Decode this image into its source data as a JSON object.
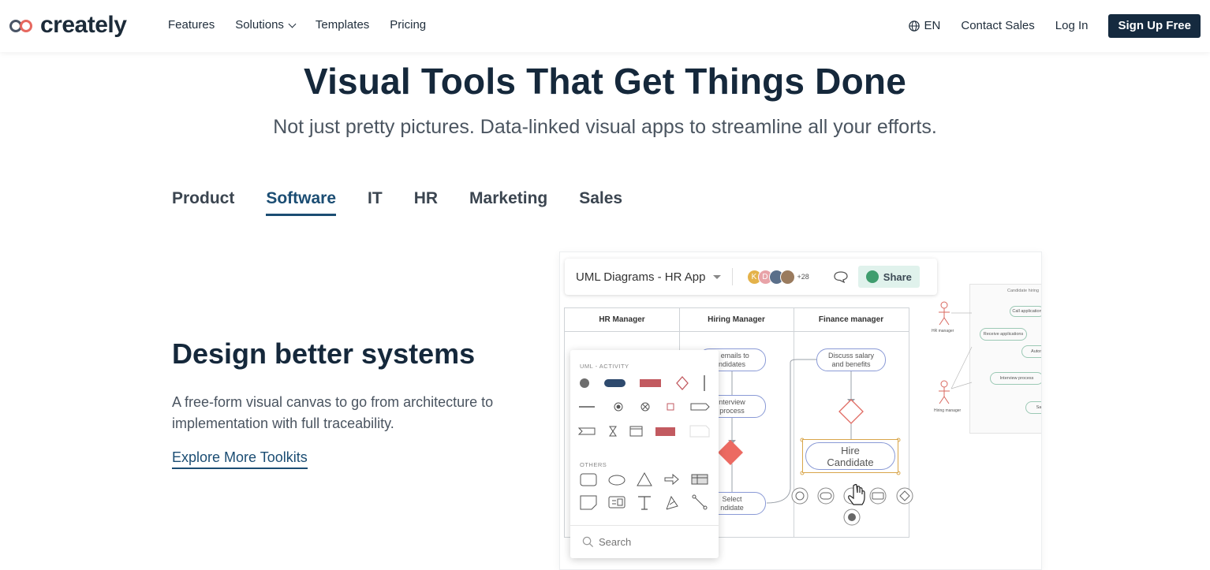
{
  "brand": {
    "name": "creately"
  },
  "nav": {
    "links": [
      "Features",
      "Solutions",
      "Templates",
      "Pricing"
    ],
    "lang": "EN",
    "contact": "Contact Sales",
    "login": "Log In",
    "signup": "Sign Up Free"
  },
  "hero": {
    "title": "Visual Tools That Get Things Done",
    "subtitle": "Not just pretty pictures. Data-linked visual apps to streamline all your efforts."
  },
  "tabs": [
    "Product",
    "Software",
    "IT",
    "HR",
    "Marketing",
    "Sales"
  ],
  "active_tab": "Software",
  "section": {
    "title": "Design better systems",
    "description": "A free-form visual canvas to go from architecture to implementation with full traceability.",
    "link": "Explore More Toolkits"
  },
  "app": {
    "doc_title": "UML Diagrams - HR App",
    "avatars": [
      "K",
      "D"
    ],
    "avatar_more": "+28",
    "share": "Share",
    "lanes": [
      "HR Manager",
      "Hiring Manager",
      "Finance manager"
    ],
    "nodes": {
      "emails": "d emails to\nndidates",
      "interview": "nterview\nprocess",
      "select": "Select\nndidate",
      "salary": "Discuss salary\nand benefits",
      "hire": "Hire\nCandidate"
    },
    "mini": {
      "title": "Candidate hiring",
      "actor1": "HR manager",
      "actor2": "Hiring manager",
      "uc1": "Call application",
      "uc2": "Receive applications",
      "uc3": "Autom",
      "uc4": "Interview process",
      "uc5": "Salar"
    },
    "panel": {
      "section1": "UML - ACTIVITY",
      "section2": "OTHERS",
      "search_placeholder": "Search"
    }
  },
  "colors": {
    "brand_dark": "#152a3f",
    "accent_blue": "#1b4d73",
    "logo_red": "#e6685f",
    "shape_red": "#c25a60",
    "shape_navy": "#2e4a6e",
    "share_green": "#3f9d6e"
  }
}
